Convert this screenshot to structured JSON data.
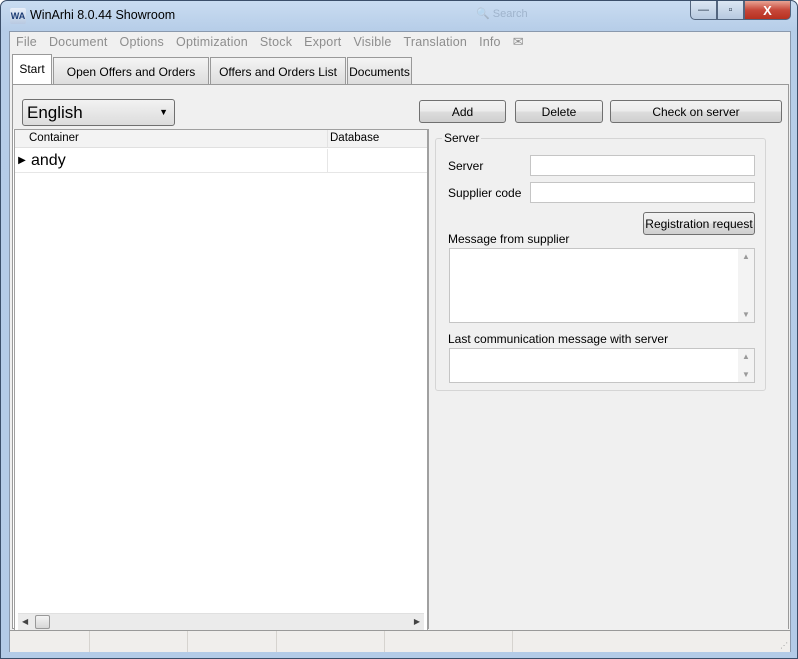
{
  "window": {
    "title": "WinArhi 8.0.44 Showroom",
    "app_icon_text": "WA",
    "search_hint": "Search"
  },
  "window_controls": {
    "minimize": "—",
    "maximize": "▫",
    "close": "X"
  },
  "menubar": {
    "items": [
      "File",
      "Document",
      "Options",
      "Optimization",
      "Stock",
      "Export",
      "Visible",
      "Translation",
      "Info"
    ],
    "mail_icon": "✉"
  },
  "tabs": [
    {
      "label": "Start",
      "active": true
    },
    {
      "label": "Open Offers and Orders",
      "active": false
    },
    {
      "label": "Offers and Orders List",
      "active": false
    },
    {
      "label": "Documents",
      "active": false
    }
  ],
  "start": {
    "language": {
      "selected": "English",
      "arrow": "▼"
    },
    "buttons": {
      "add": "Add",
      "delete": "Delete",
      "check_server": "Check on server"
    },
    "grid": {
      "columns": [
        "Container",
        "Database"
      ],
      "rows": [
        {
          "indicator": "▶",
          "container": "andy",
          "database": ""
        }
      ]
    },
    "scroll": {
      "left": "◀",
      "right": "▶"
    },
    "server_group": {
      "title": "Server",
      "server_label": "Server",
      "server_value": "",
      "supplier_code_label": "Supplier code",
      "supplier_code_value": "",
      "registration_button": "Registration request",
      "message_label": "Message from supplier",
      "message_value": "",
      "last_comm_label": "Last communication message with server",
      "last_comm_value": "",
      "scroll_up": "▲",
      "scroll_down": "▼"
    }
  },
  "statusbar": {
    "grip": "⋰"
  }
}
